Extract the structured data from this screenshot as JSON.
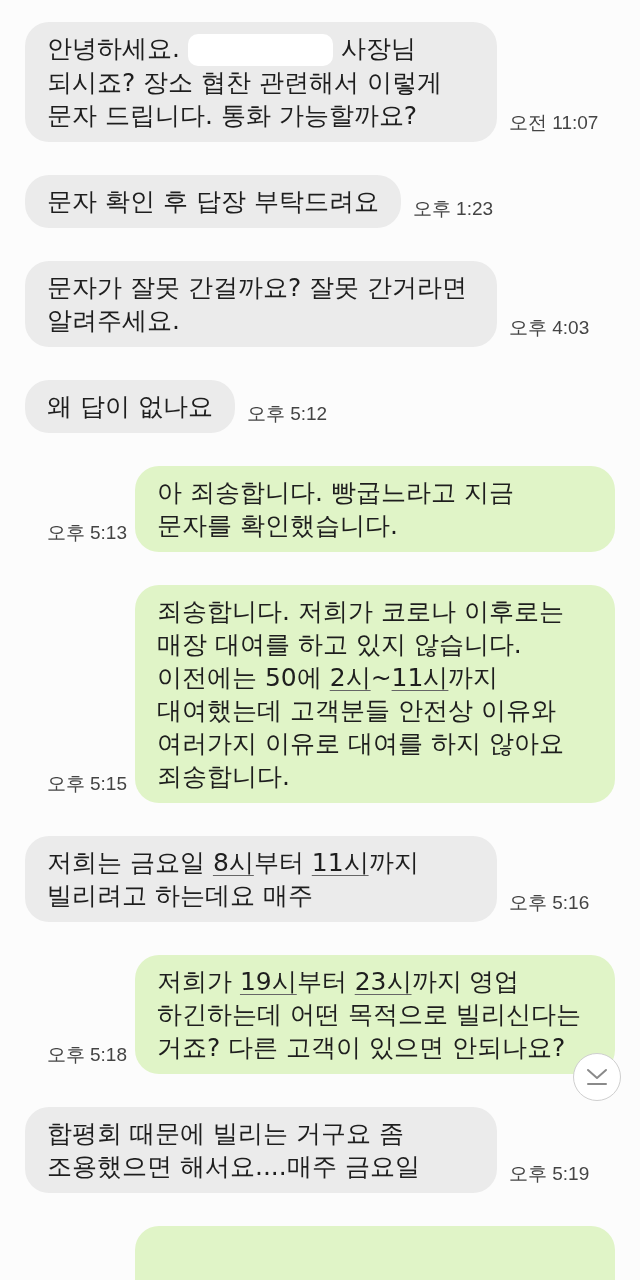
{
  "messages": [
    {
      "kind": "incoming",
      "segments": [
        {
          "kind": "text",
          "text": "안녕하세요. "
        },
        {
          "kind": "redacted"
        },
        {
          "kind": "text",
          "text": " 사장님\n되시죠? 장소 협찬 관련해서 이렇게\n문자 드립니다. 통화 가능할까요?"
        }
      ],
      "time": "오전 11:07"
    },
    {
      "kind": "incoming",
      "segments": [
        {
          "kind": "text",
          "text": "문자 확인 후 답장 부탁드려요"
        }
      ],
      "time": "오후 1:23"
    },
    {
      "kind": "incoming",
      "segments": [
        {
          "kind": "text",
          "text": "문자가 잘못 간걸까요? 잘못 간거라면\n알려주세요."
        }
      ],
      "time": "오후 4:03"
    },
    {
      "kind": "incoming",
      "segments": [
        {
          "kind": "text",
          "text": "왜 답이 없나요"
        }
      ],
      "time": "오후 5:12"
    },
    {
      "kind": "outgoing",
      "segments": [
        {
          "kind": "text",
          "text": "아 죄송합니다. 빵굽느라고 지금\n문자를 확인했습니다."
        }
      ],
      "time": "오후 5:13"
    },
    {
      "kind": "outgoing",
      "segments": [
        {
          "kind": "text",
          "text": "죄송합니다. 저희가 코로나 이후로는\n매장 대여를 하고 있지 않습니다.\n이전에는 50에 "
        },
        {
          "kind": "link",
          "text": "2시"
        },
        {
          "kind": "text",
          "text": "~"
        },
        {
          "kind": "link",
          "text": "11시"
        },
        {
          "kind": "text",
          "text": "까지\n대여했는데 고객분들 안전상 이유와\n여러가지 이유로 대여를 하지 않아요\n죄송합니다."
        }
      ],
      "time": "오후 5:15"
    },
    {
      "kind": "incoming",
      "segments": [
        {
          "kind": "text",
          "text": "저희는 금요일 "
        },
        {
          "kind": "link",
          "text": "8시"
        },
        {
          "kind": "text",
          "text": "부터 "
        },
        {
          "kind": "link",
          "text": "11시"
        },
        {
          "kind": "text",
          "text": "까지\n빌리려고 하는데요 매주"
        }
      ],
      "time": "오후 5:16"
    },
    {
      "kind": "outgoing",
      "segments": [
        {
          "kind": "text",
          "text": "저희가 "
        },
        {
          "kind": "link",
          "text": "19시"
        },
        {
          "kind": "text",
          "text": "부터 "
        },
        {
          "kind": "link",
          "text": "23시"
        },
        {
          "kind": "text",
          "text": "까지 영업\n하긴하는데 어떤 목적으로 빌리신다는\n거죠? 다른 고객이 있으면 안되나요?"
        }
      ],
      "time": "오후 5:18"
    },
    {
      "kind": "incoming",
      "segments": [
        {
          "kind": "text",
          "text": "합평회 때문에 빌리는 거구요 좀\n조용했으면 해서요....매주 금요일"
        }
      ],
      "time": "오후 5:19"
    },
    {
      "kind": "outgoing"
    }
  ]
}
